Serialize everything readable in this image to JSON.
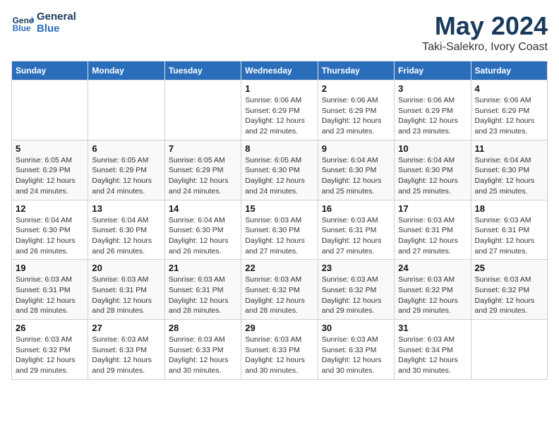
{
  "header": {
    "logo_line1": "General",
    "logo_line2": "Blue",
    "title": "May 2024",
    "subtitle": "Taki-Salekro, Ivory Coast"
  },
  "weekdays": [
    "Sunday",
    "Monday",
    "Tuesday",
    "Wednesday",
    "Thursday",
    "Friday",
    "Saturday"
  ],
  "weeks": [
    [
      {
        "day": "",
        "info": ""
      },
      {
        "day": "",
        "info": ""
      },
      {
        "day": "",
        "info": ""
      },
      {
        "day": "1",
        "info": "Sunrise: 6:06 AM\nSunset: 6:29 PM\nDaylight: 12 hours\nand 22 minutes."
      },
      {
        "day": "2",
        "info": "Sunrise: 6:06 AM\nSunset: 6:29 PM\nDaylight: 12 hours\nand 23 minutes."
      },
      {
        "day": "3",
        "info": "Sunrise: 6:06 AM\nSunset: 6:29 PM\nDaylight: 12 hours\nand 23 minutes."
      },
      {
        "day": "4",
        "info": "Sunrise: 6:06 AM\nSunset: 6:29 PM\nDaylight: 12 hours\nand 23 minutes."
      }
    ],
    [
      {
        "day": "5",
        "info": "Sunrise: 6:05 AM\nSunset: 6:29 PM\nDaylight: 12 hours\nand 24 minutes."
      },
      {
        "day": "6",
        "info": "Sunrise: 6:05 AM\nSunset: 6:29 PM\nDaylight: 12 hours\nand 24 minutes."
      },
      {
        "day": "7",
        "info": "Sunrise: 6:05 AM\nSunset: 6:29 PM\nDaylight: 12 hours\nand 24 minutes."
      },
      {
        "day": "8",
        "info": "Sunrise: 6:05 AM\nSunset: 6:30 PM\nDaylight: 12 hours\nand 24 minutes."
      },
      {
        "day": "9",
        "info": "Sunrise: 6:04 AM\nSunset: 6:30 PM\nDaylight: 12 hours\nand 25 minutes."
      },
      {
        "day": "10",
        "info": "Sunrise: 6:04 AM\nSunset: 6:30 PM\nDaylight: 12 hours\nand 25 minutes."
      },
      {
        "day": "11",
        "info": "Sunrise: 6:04 AM\nSunset: 6:30 PM\nDaylight: 12 hours\nand 25 minutes."
      }
    ],
    [
      {
        "day": "12",
        "info": "Sunrise: 6:04 AM\nSunset: 6:30 PM\nDaylight: 12 hours\nand 26 minutes."
      },
      {
        "day": "13",
        "info": "Sunrise: 6:04 AM\nSunset: 6:30 PM\nDaylight: 12 hours\nand 26 minutes."
      },
      {
        "day": "14",
        "info": "Sunrise: 6:04 AM\nSunset: 6:30 PM\nDaylight: 12 hours\nand 26 minutes."
      },
      {
        "day": "15",
        "info": "Sunrise: 6:03 AM\nSunset: 6:30 PM\nDaylight: 12 hours\nand 27 minutes."
      },
      {
        "day": "16",
        "info": "Sunrise: 6:03 AM\nSunset: 6:31 PM\nDaylight: 12 hours\nand 27 minutes."
      },
      {
        "day": "17",
        "info": "Sunrise: 6:03 AM\nSunset: 6:31 PM\nDaylight: 12 hours\nand 27 minutes."
      },
      {
        "day": "18",
        "info": "Sunrise: 6:03 AM\nSunset: 6:31 PM\nDaylight: 12 hours\nand 27 minutes."
      }
    ],
    [
      {
        "day": "19",
        "info": "Sunrise: 6:03 AM\nSunset: 6:31 PM\nDaylight: 12 hours\nand 28 minutes."
      },
      {
        "day": "20",
        "info": "Sunrise: 6:03 AM\nSunset: 6:31 PM\nDaylight: 12 hours\nand 28 minutes."
      },
      {
        "day": "21",
        "info": "Sunrise: 6:03 AM\nSunset: 6:31 PM\nDaylight: 12 hours\nand 28 minutes."
      },
      {
        "day": "22",
        "info": "Sunrise: 6:03 AM\nSunset: 6:32 PM\nDaylight: 12 hours\nand 28 minutes."
      },
      {
        "day": "23",
        "info": "Sunrise: 6:03 AM\nSunset: 6:32 PM\nDaylight: 12 hours\nand 29 minutes."
      },
      {
        "day": "24",
        "info": "Sunrise: 6:03 AM\nSunset: 6:32 PM\nDaylight: 12 hours\nand 29 minutes."
      },
      {
        "day": "25",
        "info": "Sunrise: 6:03 AM\nSunset: 6:32 PM\nDaylight: 12 hours\nand 29 minutes."
      }
    ],
    [
      {
        "day": "26",
        "info": "Sunrise: 6:03 AM\nSunset: 6:32 PM\nDaylight: 12 hours\nand 29 minutes."
      },
      {
        "day": "27",
        "info": "Sunrise: 6:03 AM\nSunset: 6:33 PM\nDaylight: 12 hours\nand 29 minutes."
      },
      {
        "day": "28",
        "info": "Sunrise: 6:03 AM\nSunset: 6:33 PM\nDaylight: 12 hours\nand 30 minutes."
      },
      {
        "day": "29",
        "info": "Sunrise: 6:03 AM\nSunset: 6:33 PM\nDaylight: 12 hours\nand 30 minutes."
      },
      {
        "day": "30",
        "info": "Sunrise: 6:03 AM\nSunset: 6:33 PM\nDaylight: 12 hours\nand 30 minutes."
      },
      {
        "day": "31",
        "info": "Sunrise: 6:03 AM\nSunset: 6:34 PM\nDaylight: 12 hours\nand 30 minutes."
      },
      {
        "day": "",
        "info": ""
      }
    ]
  ]
}
